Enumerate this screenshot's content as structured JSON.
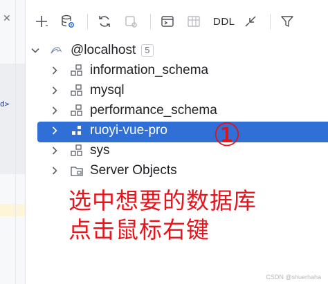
{
  "toolbar": {
    "items": [
      {
        "icon": "plus-icon"
      },
      {
        "icon": "datasource-properties-icon"
      },
      {
        "icon": "refresh-icon"
      },
      {
        "icon": "stop-icon"
      },
      {
        "icon": "console-icon"
      },
      {
        "icon": "table-icon"
      },
      {
        "icon": "ddl"
      },
      {
        "icon": "jump-to-icon"
      },
      {
        "icon": "filter-icon"
      }
    ],
    "ddl_label": "DDL"
  },
  "tree": {
    "root": {
      "label": "@localhost",
      "count": "5"
    },
    "children": [
      {
        "label": "information_schema",
        "icon": "schema-icon"
      },
      {
        "label": "mysql",
        "icon": "schema-icon"
      },
      {
        "label": "performance_schema",
        "icon": "schema-icon"
      },
      {
        "label": "ruoyi-vue-pro",
        "icon": "schema-icon",
        "selected": true
      },
      {
        "label": "sys",
        "icon": "schema-icon"
      },
      {
        "label": "Server Objects",
        "icon": "folder-icon"
      }
    ]
  },
  "annotation": {
    "marker": "①",
    "line1": "选中想要的数据库",
    "line2": "点击鼠标右键"
  },
  "left_fragment": "d>",
  "watermark": "CSDN @shuerhaha",
  "colors": {
    "selection": "#2f6fd6",
    "annotation": "#e8131b",
    "text": "#1f2023"
  }
}
